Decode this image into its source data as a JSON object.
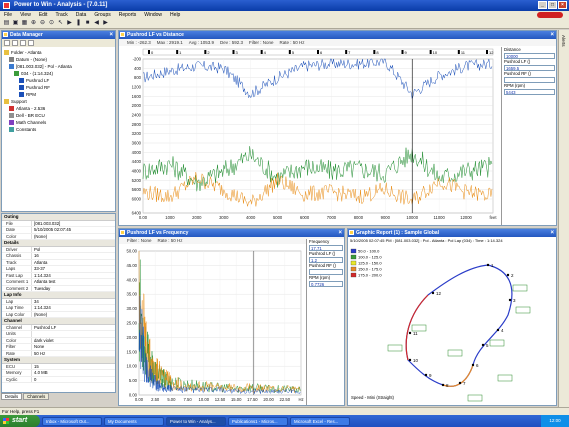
{
  "window": {
    "title": "Power to Win - Analysis - [7.0.11]",
    "min": "_",
    "max": "□",
    "close": "×"
  },
  "menu": [
    "File",
    "View",
    "Edit",
    "Track",
    "Data",
    "Groups",
    "Reports",
    "Window",
    "Help"
  ],
  "toolbar_icons": [
    "open-icon",
    "save-icon",
    "print-icon",
    "zoom-in-icon",
    "zoom-out-icon",
    "zoom-fit-icon",
    "cursor-icon",
    "play-icon",
    "pause-icon",
    "stop-icon",
    "back-icon",
    "forward-icon"
  ],
  "sidebar_tab": "Alerts",
  "data_manager": {
    "title": "Data Manager",
    "tree": [
      {
        "label": "Folder - Atlanta",
        "level": 0,
        "icon": "folder-icon"
      },
      {
        "label": "Datum - (None)",
        "level": 1,
        "icon": "datum-icon"
      },
      {
        "label": "[081.003.032] - Pol - Atlanta",
        "level": 1,
        "icon": "run-icon"
      },
      {
        "label": "034 - (1:14.324)",
        "level": 2,
        "icon": "lap-icon"
      },
      {
        "label": "Pushrod LF",
        "level": 3,
        "icon": "channel-icon"
      },
      {
        "label": "Pushrod RF",
        "level": 3,
        "icon": "channel-icon"
      },
      {
        "label": "RPM",
        "level": 3,
        "icon": "channel-icon"
      },
      {
        "label": "Support",
        "level": 0,
        "icon": "folder-icon"
      },
      {
        "label": "Atlanta - 2.536",
        "level": 1,
        "icon": "track-icon"
      },
      {
        "label": "Dell - BR ECU",
        "level": 1,
        "icon": "device-icon"
      },
      {
        "label": "Math Channels",
        "level": 1,
        "icon": "math-icon"
      },
      {
        "label": "Constants",
        "level": 1,
        "icon": "constant-icon"
      }
    ]
  },
  "properties": {
    "sections": [
      {
        "name": "Outing",
        "rows": [
          [
            "File",
            "[081.003.032]"
          ],
          [
            "Date",
            "5/10/2005  02:07:45"
          ],
          [
            "Color",
            "(None)"
          ]
        ]
      },
      {
        "name": "Details",
        "rows": [
          [
            "Driver",
            "Pol"
          ],
          [
            "Chassis",
            "16"
          ],
          [
            "Track",
            "Atlanta"
          ],
          [
            "Laps",
            "33-37"
          ],
          [
            "Fast Lap",
            "1:14.324"
          ],
          [
            "Comment 1",
            "Atlanta test"
          ],
          [
            "Comment 2",
            "Tuesday"
          ]
        ]
      },
      {
        "name": "Lap Info",
        "rows": [
          [
            "Lap",
            "34"
          ],
          [
            "Lap Time",
            "1:14.324"
          ],
          [
            "Lap Color",
            "(None)"
          ]
        ]
      },
      {
        "name": "Channel",
        "rows": [
          [
            "Channel",
            "Pushrod LF"
          ],
          [
            "Units",
            ""
          ],
          [
            "Color",
            "dark violet"
          ],
          [
            "Filter",
            "None"
          ],
          [
            "Rate",
            "50 Hz"
          ]
        ]
      },
      {
        "name": "System",
        "rows": [
          [
            "ECU",
            "15"
          ],
          [
            "Memory",
            "4.0 MB"
          ],
          [
            "Cyclic",
            "0"
          ]
        ]
      }
    ],
    "tabs": [
      "Details",
      "Channels"
    ]
  },
  "distance_chart": {
    "title": "Pushrod LF vs Distance",
    "info": [
      "Min : -262.3",
      "Max : 2919.1",
      "Avg : 1053.9",
      "Dev : 592.3",
      "Filter : None",
      "Rate : 50 Hz"
    ],
    "segments": [
      "0",
      "1",
      "2",
      "3",
      "4",
      "5",
      "6",
      "7",
      "8",
      "9",
      "10",
      "11",
      "12"
    ],
    "legend": {
      "title": "Distance",
      "distance": "10000",
      "items": [
        {
          "label": "Pushrod LF ()",
          "value": "1659.5"
        },
        {
          "label": "Pushrod RF ()",
          "value": ""
        },
        {
          "label": "RPM (rpm)",
          "value": "5443"
        }
      ]
    }
  },
  "frequency_chart": {
    "title": "Pushrod LF vs Frequency",
    "info": [
      "Filter : None",
      "Rate : 50 Hz"
    ],
    "legend": {
      "title": "Frequency",
      "freq": "17.71",
      "items": [
        {
          "label": "Pushrod LF ()",
          "value": "1.2"
        },
        {
          "label": "Pushrod RF ()",
          "value": ""
        },
        {
          "label": "RPM (rpm)",
          "value": "0.7726"
        }
      ]
    }
  },
  "graphic_report": {
    "title": "Graphic Report (1) : Sample Global",
    "header": "5/10/2005 02:07:45 PM : [081.003.032] : Pol - Atlanta : Pol Lap (034) : Time : 1:14.324",
    "speed_legend": [
      {
        "label": "50.0 - 100.0",
        "color": "#2a3cc8"
      },
      {
        "label": "100.0 - 125.0",
        "color": "#3a9c3a"
      },
      {
        "label": "125.0 - 150.0",
        "color": "#e8e82a"
      },
      {
        "label": "150.0 - 175.0",
        "color": "#e88a2a"
      },
      {
        "label": "175.0 - 200.0",
        "color": "#d22a2a"
      }
    ],
    "footer": "Speed - Mini (Straight)",
    "segment_labels": [
      "1",
      "2",
      "3",
      "4",
      "5",
      "6",
      "7",
      "8",
      "9",
      "10",
      "11",
      "12"
    ]
  },
  "status": "For Help, press F1",
  "taskbar": {
    "start": "start",
    "tasks": [
      "Inbox - Microsoft Out...",
      "My Documents",
      "Power to Win - Analys...",
      "Publications1 - Micros...",
      "Microsoft Excel - Res..."
    ],
    "clock": "12:00"
  },
  "chart_data": [
    {
      "type": "line",
      "title": "Pushrod LF vs Distance",
      "x": [
        0,
        1000,
        2000,
        3000,
        4000,
        5000,
        6000,
        7000,
        8000,
        9000,
        10000,
        11000,
        12000,
        13000
      ],
      "x_tick_labels": [
        "0.00",
        "1000",
        "2000",
        "3000",
        "4000",
        "5000",
        "6000",
        "7000",
        "8000",
        "9000",
        "10000",
        "11000",
        "12000",
        "feet"
      ],
      "y_tick_labels": [
        "-200",
        "400",
        "800",
        "1200",
        "1600",
        "2000",
        "2400",
        "2800",
        "3200",
        "3600",
        "4000",
        "4400",
        "4800",
        "5200",
        "5600",
        "6000",
        "6400"
      ],
      "y_ticks": [
        6400,
        6000,
        5600,
        5200,
        4800,
        4400,
        4000,
        3600,
        3200,
        2800,
        2400,
        2000,
        1600,
        1200,
        800,
        400,
        -200
      ],
      "series": [
        {
          "name": "RPM (rpm)",
          "color": "#1a4fb8",
          "values": [
            5600,
            5900,
            6100,
            6000,
            4900,
            5600,
            6100,
            6200,
            6200,
            6300,
            4900,
            5700,
            6100,
            6200
          ]
        },
        {
          "name": "Pushrod LF ()",
          "color": "#1a8a2a",
          "values": [
            1600,
            1900,
            1100,
            1600,
            2300,
            1300,
            1800,
            1600,
            1700,
            1500,
            2400,
            1300,
            1600,
            1800
          ]
        },
        {
          "name": "Pushrod RF ()",
          "color": "#e88a10",
          "values": [
            700,
            500,
            1300,
            800,
            200,
            1200,
            600,
            700,
            500,
            800,
            300,
            1200,
            700,
            500
          ]
        }
      ]
    },
    {
      "type": "line",
      "title": "Pushrod LF vs Frequency",
      "x": [
        0,
        1,
        2,
        3,
        4,
        5,
        7.5,
        10,
        12.5,
        15,
        17.5,
        20,
        22.5,
        25
      ],
      "x_tick_labels": [
        "0.00",
        "2.50",
        "5.00",
        "7.50",
        "10.00",
        "12.50",
        "15.00",
        "17.50",
        "20.00",
        "22.50",
        "Hz"
      ],
      "y_tick_labels": [
        "50.00",
        "45.00",
        "40.00",
        "35.00",
        "30.00",
        "25.00",
        "20.00",
        "15.00",
        "10.00",
        "5.00",
        "0.00"
      ],
      "y_ticks": [
        50,
        45,
        40,
        35,
        30,
        25,
        20,
        15,
        10,
        5,
        0
      ],
      "series": [
        {
          "name": "Pushrod LF ()",
          "color": "#1a8a2a",
          "values": [
            38,
            18,
            11,
            8,
            6,
            5,
            4,
            3.5,
            3,
            2.5,
            3,
            2.5,
            2.5,
            2
          ]
        },
        {
          "name": "Pushrod RF ()",
          "color": "#e88a10",
          "values": [
            44,
            20,
            12,
            9,
            7,
            5,
            4,
            3.5,
            3,
            3,
            3,
            2.5,
            2.5,
            2
          ]
        },
        {
          "name": "RPM (rpm)",
          "color": "#1a4fb8",
          "values": [
            30,
            12,
            6,
            4,
            3,
            2.5,
            2,
            2,
            2,
            1.5,
            1.5,
            1.5,
            1.5,
            1.5
          ]
        }
      ]
    }
  ]
}
